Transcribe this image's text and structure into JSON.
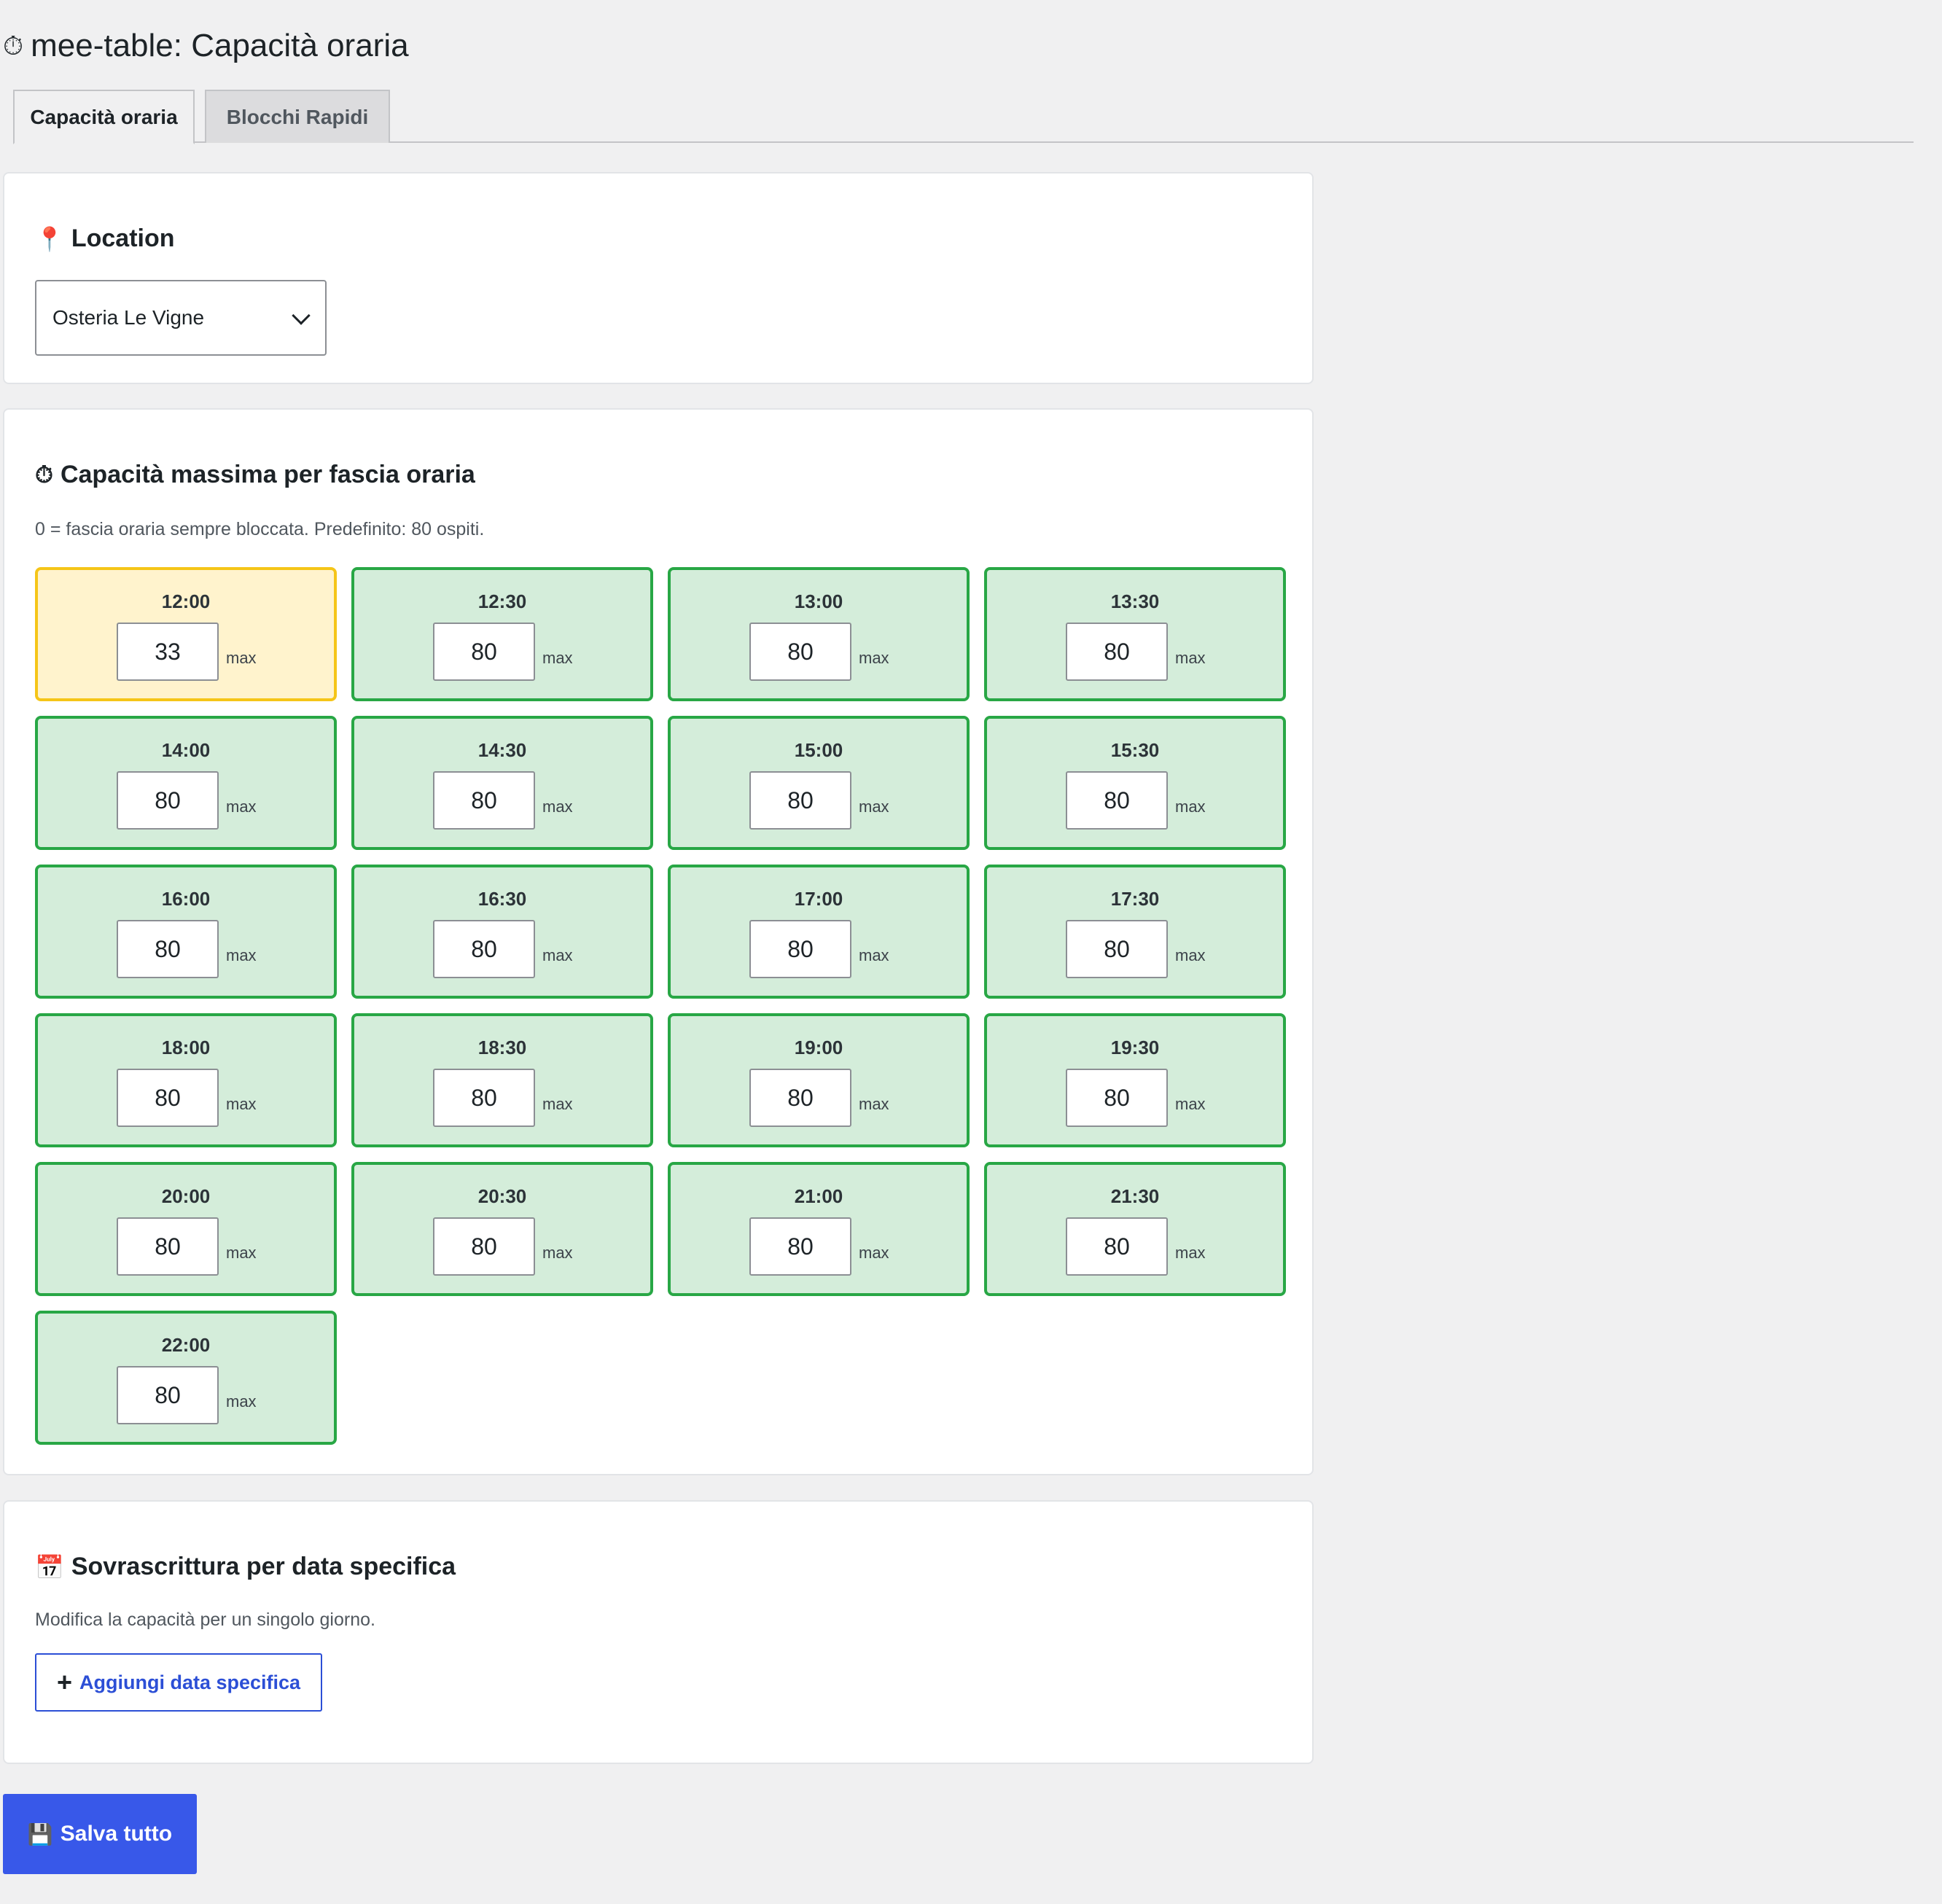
{
  "page": {
    "title": "mee-table: Capacità oraria",
    "title_icon": "clock-icon"
  },
  "tabs": [
    {
      "label": "Capacità oraria",
      "active": true
    },
    {
      "label": "Blocchi Rapidi",
      "active": false
    }
  ],
  "location": {
    "title": "Location",
    "icon": "pin-icon",
    "selected": "Osteria Le Vigne"
  },
  "capacity": {
    "title": "Capacità massima per fascia oraria",
    "icon": "clock-icon",
    "hint": "0 = fascia oraria sempre bloccata. Predefinito: 80 ospiti.",
    "max_label": "max",
    "slots": [
      {
        "time": "12:00",
        "value": "33",
        "status": "modified"
      },
      {
        "time": "12:30",
        "value": "80",
        "status": "default"
      },
      {
        "time": "13:00",
        "value": "80",
        "status": "default"
      },
      {
        "time": "13:30",
        "value": "80",
        "status": "default"
      },
      {
        "time": "14:00",
        "value": "80",
        "status": "default"
      },
      {
        "time": "14:30",
        "value": "80",
        "status": "default"
      },
      {
        "time": "15:00",
        "value": "80",
        "status": "default"
      },
      {
        "time": "15:30",
        "value": "80",
        "status": "default"
      },
      {
        "time": "16:00",
        "value": "80",
        "status": "default"
      },
      {
        "time": "16:30",
        "value": "80",
        "status": "default"
      },
      {
        "time": "17:00",
        "value": "80",
        "status": "default"
      },
      {
        "time": "17:30",
        "value": "80",
        "status": "default"
      },
      {
        "time": "18:00",
        "value": "80",
        "status": "default"
      },
      {
        "time": "18:30",
        "value": "80",
        "status": "default"
      },
      {
        "time": "19:00",
        "value": "80",
        "status": "default"
      },
      {
        "time": "19:30",
        "value": "80",
        "status": "default"
      },
      {
        "time": "20:00",
        "value": "80",
        "status": "default"
      },
      {
        "time": "20:30",
        "value": "80",
        "status": "default"
      },
      {
        "time": "21:00",
        "value": "80",
        "status": "default"
      },
      {
        "time": "21:30",
        "value": "80",
        "status": "default"
      },
      {
        "time": "22:00",
        "value": "80",
        "status": "default"
      }
    ]
  },
  "override": {
    "title": "Sovrascrittura per data specifica",
    "icon": "calendar-icon",
    "hint": "Modifica la capacità per un singolo giorno.",
    "add_button": "Aggiungi data specifica"
  },
  "save_button": "Salva tutto",
  "colors": {
    "slot_default_bg": "#d4edda",
    "slot_default_border": "#28a745",
    "slot_modified_bg": "#fff3cd",
    "slot_modified_border": "#f5c518",
    "primary": "#3858e9"
  }
}
